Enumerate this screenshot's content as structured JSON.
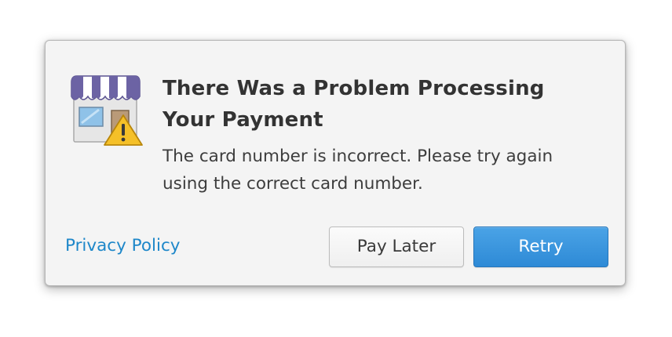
{
  "dialog": {
    "icon": "store-warning-icon",
    "title": "There Was a Problem Processing Your Payment",
    "message": "The card number is incorrect. Please try again using the correct card number.",
    "privacy_link": "Privacy Policy",
    "buttons": {
      "pay_later": "Pay Later",
      "retry": "Retry"
    }
  },
  "colors": {
    "dialog_bg": "#f4f4f4",
    "link": "#1e87c9",
    "primary_button": "#3594dc",
    "awning": "#6c63a4",
    "warning": "#f5c028"
  }
}
